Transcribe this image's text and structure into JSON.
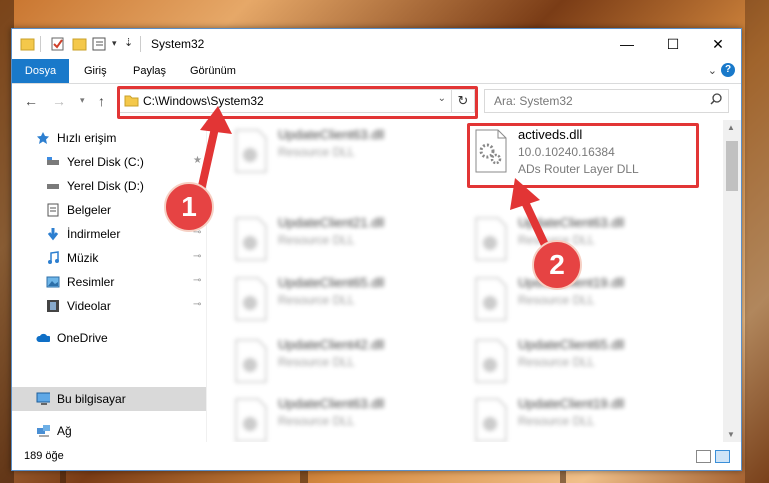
{
  "window": {
    "title": "System32"
  },
  "ribbon": {
    "tabs": [
      "Dosya",
      "Giriş",
      "Paylaş",
      "Görünüm"
    ],
    "help": "?"
  },
  "address": {
    "path": "C:\\Windows\\System32"
  },
  "search": {
    "placeholder": "Ara: System32"
  },
  "sidebar": {
    "items": [
      {
        "label": "Hızlı erişim",
        "icon": "star-icon"
      },
      {
        "label": "Yerel Disk (C:)",
        "icon": "drive-icon",
        "pinned": true
      },
      {
        "label": "Yerel Disk (D:)",
        "icon": "drive-icon"
      },
      {
        "label": "Belgeler",
        "icon": "documents-icon",
        "pinned": true
      },
      {
        "label": "İndirmeler",
        "icon": "download-icon",
        "pinned": true
      },
      {
        "label": "Müzik",
        "icon": "music-icon",
        "pinned": true
      },
      {
        "label": "Resimler",
        "icon": "pictures-icon",
        "pinned": true
      },
      {
        "label": "Videolar",
        "icon": "videos-icon",
        "pinned": true
      },
      {
        "label": "OneDrive",
        "icon": "cloud-icon"
      },
      {
        "label": "Bu bilgisayar",
        "icon": "computer-icon",
        "selected": true
      },
      {
        "label": "Ağ",
        "icon": "network-icon"
      }
    ]
  },
  "files": {
    "left": [
      {
        "name": "UpdateClient63.dll",
        "desc": "Resource DLL"
      },
      {
        "name": "UpdateClient21.dll",
        "desc": "Resource DLL"
      },
      {
        "name": "UpdateClient65.dll",
        "desc": "Resource DLL"
      },
      {
        "name": "UpdateClient42.dll",
        "desc": "Resource DLL"
      },
      {
        "name": "UpdateClient63.dll",
        "desc": "Resource DLL"
      }
    ],
    "right": [
      {
        "name": "activeds.dll",
        "desc": "10.0.10240.16384",
        "desc2": "ADs Router Layer DLL"
      },
      {
        "name": "UpdateClient63.dll",
        "desc": "Resource DLL"
      },
      {
        "name": "UpdateClient19.dll",
        "desc": "Resource DLL"
      },
      {
        "name": "UpdateClient65.dll",
        "desc": "Resource DLL"
      },
      {
        "name": "UpdateClient19.dll",
        "desc": "Resource DLL"
      }
    ]
  },
  "status": {
    "count": "189 öğe"
  },
  "annotations": {
    "step1": "1",
    "step2": "2"
  },
  "colors": {
    "accent": "#1979ca",
    "highlight": "#e23535",
    "badge": "#e64343"
  }
}
